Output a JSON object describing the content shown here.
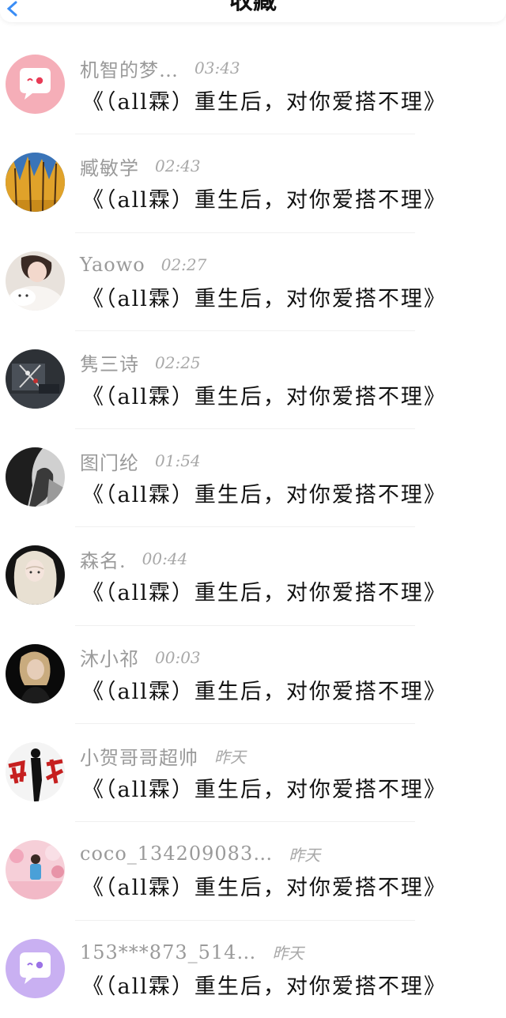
{
  "header": {
    "title": "收藏"
  },
  "items": [
    {
      "name": "机智的梦…",
      "time": "03:43",
      "message": "《（all霖）重生后，对你爱搭不理》",
      "avatar": "default-pink-avatar"
    },
    {
      "name": "臧敏学",
      "time": "02:43",
      "message": "《（all霖）重生后，对你爱搭不理》",
      "avatar": "photo-avatar-trees"
    },
    {
      "name": "Yaowo",
      "time": "02:27",
      "message": "《（all霖）重生后，对你爱搭不理》",
      "avatar": "photo-avatar-girl-cat"
    },
    {
      "name": "隽三诗",
      "time": "02:25",
      "message": "《（all霖）重生后，对你爱搭不理》",
      "avatar": "photo-avatar-dark-board"
    },
    {
      "name": "图门纶",
      "time": "01:54",
      "message": "《（all霖）重生后，对你爱搭不理》",
      "avatar": "photo-avatar-dark-figure"
    },
    {
      "name": "森名.",
      "time": "00:44",
      "message": "《（all霖）重生后，对你爱搭不理》",
      "avatar": "photo-avatar-blonde"
    },
    {
      "name": "沐小祁",
      "time": "00:03",
      "message": "《（all霖）重生后，对你爱搭不理》",
      "avatar": "photo-avatar-dark-portrait"
    },
    {
      "name": "小贺哥哥超帅",
      "time": "昨天",
      "message": "《（all霖）重生后，对你爱搭不理》",
      "avatar": "photo-avatar-red-calligraphy"
    },
    {
      "name": "coco_134209083…",
      "time": "昨天",
      "message": "《（all霖）重生后，对你爱搭不理》",
      "avatar": "photo-avatar-pink-kid"
    },
    {
      "name": "153***873_514…",
      "time": "昨天",
      "message": "《（all霖）重生后，对你爱搭不理》",
      "avatar": "default-purple-avatar"
    }
  ]
}
